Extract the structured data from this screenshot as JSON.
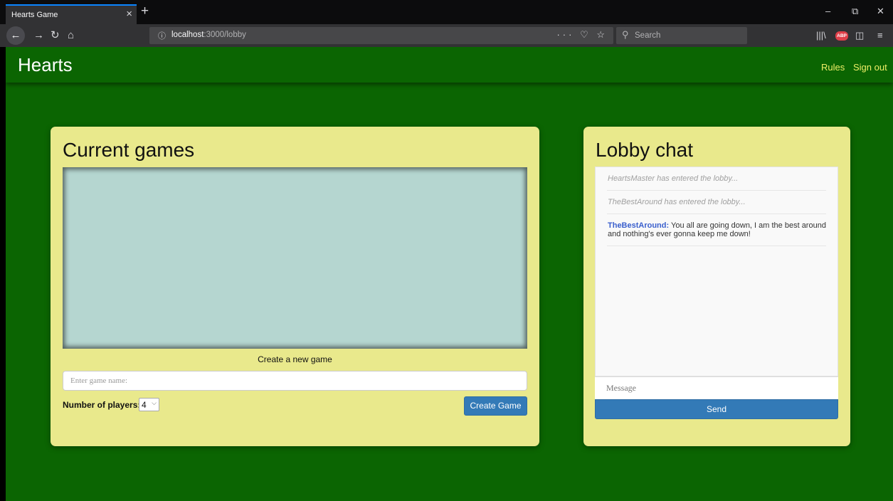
{
  "browser": {
    "tab_title": "Hearts Game",
    "tab_close": "×",
    "new_tab": "+",
    "info_icon": "ⓘ",
    "url_host": "localhost",
    "url_rest": ":3000/lobby",
    "page_actions": "··· ♡ ☆",
    "search_placeholder": "Search",
    "icons": [
      "back-arrow-icon",
      "forward-arrow-icon",
      "reload-icon",
      "home-icon",
      "library-icon",
      "adblock-icon",
      "sidebar-icon",
      "menu-icon"
    ],
    "abp_label": "ABP",
    "window_controls": {
      "minimize": "–",
      "restore": "⧉",
      "close": "✕"
    }
  },
  "navbar": {
    "brand": "Hearts",
    "links": [
      "Rules",
      "Sign out"
    ]
  },
  "games_panel": {
    "title": "Current games",
    "create_label": "Create a new game",
    "name_placeholder": "Enter game name:",
    "players_label": "Number of players:",
    "players_value": "4",
    "create_button": "Create Game"
  },
  "chat_panel": {
    "title": "Lobby chat",
    "messages": [
      {
        "type": "system",
        "text": "HeartsMaster has entered the lobby..."
      },
      {
        "type": "system",
        "text": "TheBestAround has entered the lobby..."
      },
      {
        "type": "user",
        "user": "TheBestAround:",
        "text": " You all are going down, I am the best around and nothing's ever gonna keep me down!"
      }
    ],
    "message_placeholder": "Message",
    "send_button": "Send"
  },
  "colors": {
    "page_bg": "#0b6502",
    "card_bg": "#e9e98c",
    "games_box_bg": "#b5d6d0",
    "button_blue": "#337ab7",
    "nav_link": "#eeee66",
    "chat_user": "#3a5fcd"
  }
}
